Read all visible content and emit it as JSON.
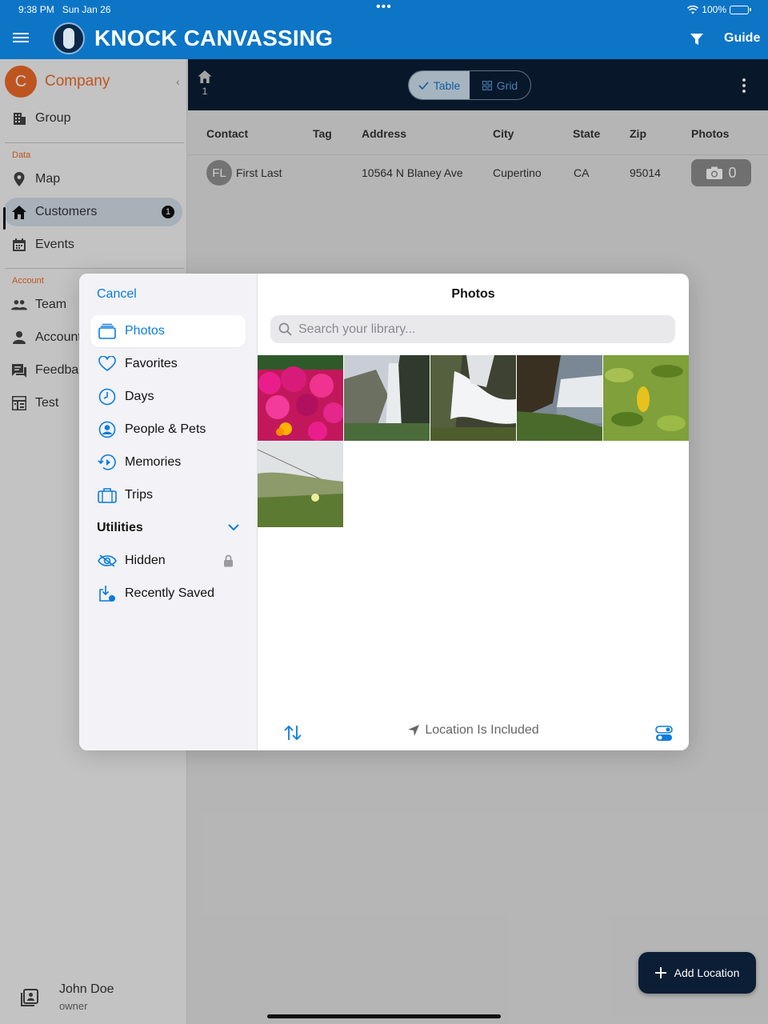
{
  "status": {
    "time": "9:38 PM",
    "date": "Sun Jan 26",
    "battery": "100%"
  },
  "app": {
    "brand": "KNOCK CANVASSING",
    "guide_label": "Guide"
  },
  "sidebar": {
    "company_initial": "C",
    "company_name": "Company",
    "group_label": "Group",
    "data_section": "Data",
    "items_data": [
      {
        "label": "Map",
        "icon": "map-pin-icon"
      },
      {
        "label": "Customers",
        "icon": "house-icon",
        "badge": "1"
      },
      {
        "label": "Events",
        "icon": "calendar-icon"
      }
    ],
    "account_section": "Account",
    "items_account": [
      {
        "label": "Team",
        "icon": "people-icon"
      },
      {
        "label": "Account",
        "icon": "person-icon"
      },
      {
        "label": "Feedback",
        "icon": "feedback-icon"
      },
      {
        "label": "Test",
        "icon": "table-icon"
      }
    ],
    "user_name": "John Doe",
    "user_role": "owner"
  },
  "navbar": {
    "home_count": "1",
    "view_table": "Table",
    "view_grid": "Grid"
  },
  "table": {
    "headers": [
      "Contact",
      "Tag",
      "Address",
      "City",
      "State",
      "Zip",
      "Photos"
    ],
    "rows": [
      {
        "initials": "FL",
        "contact": "First Last",
        "tag": "",
        "address": "10564 N Blaney Ave",
        "city": "Cupertino",
        "state": "CA",
        "zip": "95014",
        "photos": "0"
      }
    ]
  },
  "add_location_label": "Add Location",
  "picker": {
    "cancel_label": "Cancel",
    "title": "Photos",
    "search_placeholder": "Search your library...",
    "items": [
      {
        "label": "Photos",
        "icon": "photos-stack-icon"
      },
      {
        "label": "Favorites",
        "icon": "heart-icon"
      },
      {
        "label": "Days",
        "icon": "clock-icon"
      },
      {
        "label": "People & Pets",
        "icon": "person-circle-icon"
      },
      {
        "label": "Memories",
        "icon": "memories-icon"
      },
      {
        "label": "Trips",
        "icon": "suitcase-icon"
      }
    ],
    "utilities_label": "Utilities",
    "utility_items": [
      {
        "label": "Hidden",
        "icon": "eye-slash-icon"
      },
      {
        "label": "Recently Saved",
        "icon": "download-icon"
      }
    ],
    "footer_location": "Location Is Included",
    "photo_count": 6
  }
}
